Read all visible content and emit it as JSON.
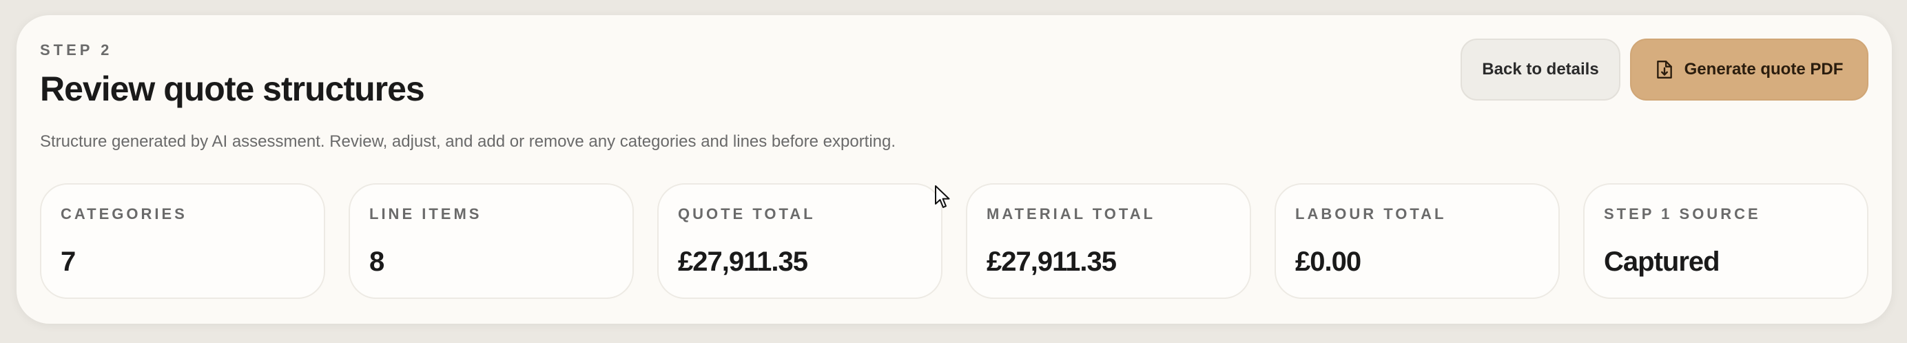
{
  "header": {
    "step": "STEP 2",
    "title": "Review quote structures",
    "subtitle": "Structure generated by AI assessment. Review, adjust, and add or remove any categories and lines before exporting."
  },
  "actions": {
    "back_label": "Back to details",
    "generate_label": "Generate quote PDF",
    "generate_icon": "file-download-icon"
  },
  "stats": [
    {
      "label": "CATEGORIES",
      "value": "7"
    },
    {
      "label": "LINE ITEMS",
      "value": "8"
    },
    {
      "label": "QUOTE TOTAL",
      "value": "£27,911.35"
    },
    {
      "label": "MATERIAL TOTAL",
      "value": "£27,911.35"
    },
    {
      "label": "LABOUR TOTAL",
      "value": "£0.00"
    },
    {
      "label": "STEP 1 SOURCE",
      "value": "Captured"
    }
  ],
  "colors": {
    "accent": "#d6ad7e",
    "panel": "#fcfaf6",
    "background": "#ebe8e2"
  }
}
